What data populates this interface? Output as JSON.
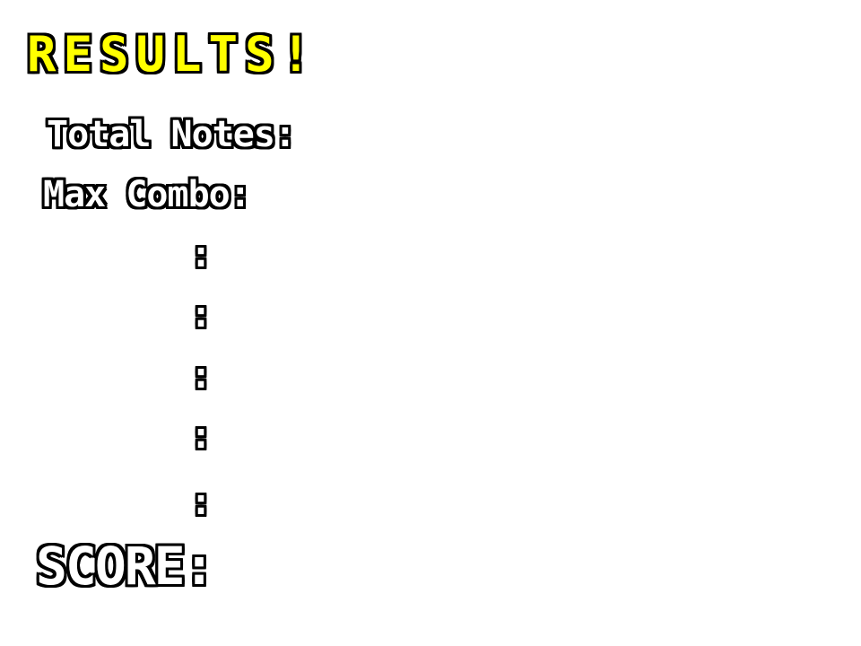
{
  "results_screen": {
    "title": "RESULTS!",
    "total_notes_label": "Total Notes:",
    "max_combo_label": "Max Combo:",
    "judgement_rows": [
      {
        "label": "",
        "colon": ":"
      },
      {
        "label": "",
        "colon": ":"
      },
      {
        "label": "",
        "colon": ":"
      },
      {
        "label": "",
        "colon": ":"
      },
      {
        "label": "",
        "colon": ":"
      }
    ],
    "score_label": "SCORE:"
  },
  "colors": {
    "background": "#ffffff",
    "title_fill": "#ffff00",
    "text_fill": "#ffffff",
    "outline": "#000000"
  }
}
